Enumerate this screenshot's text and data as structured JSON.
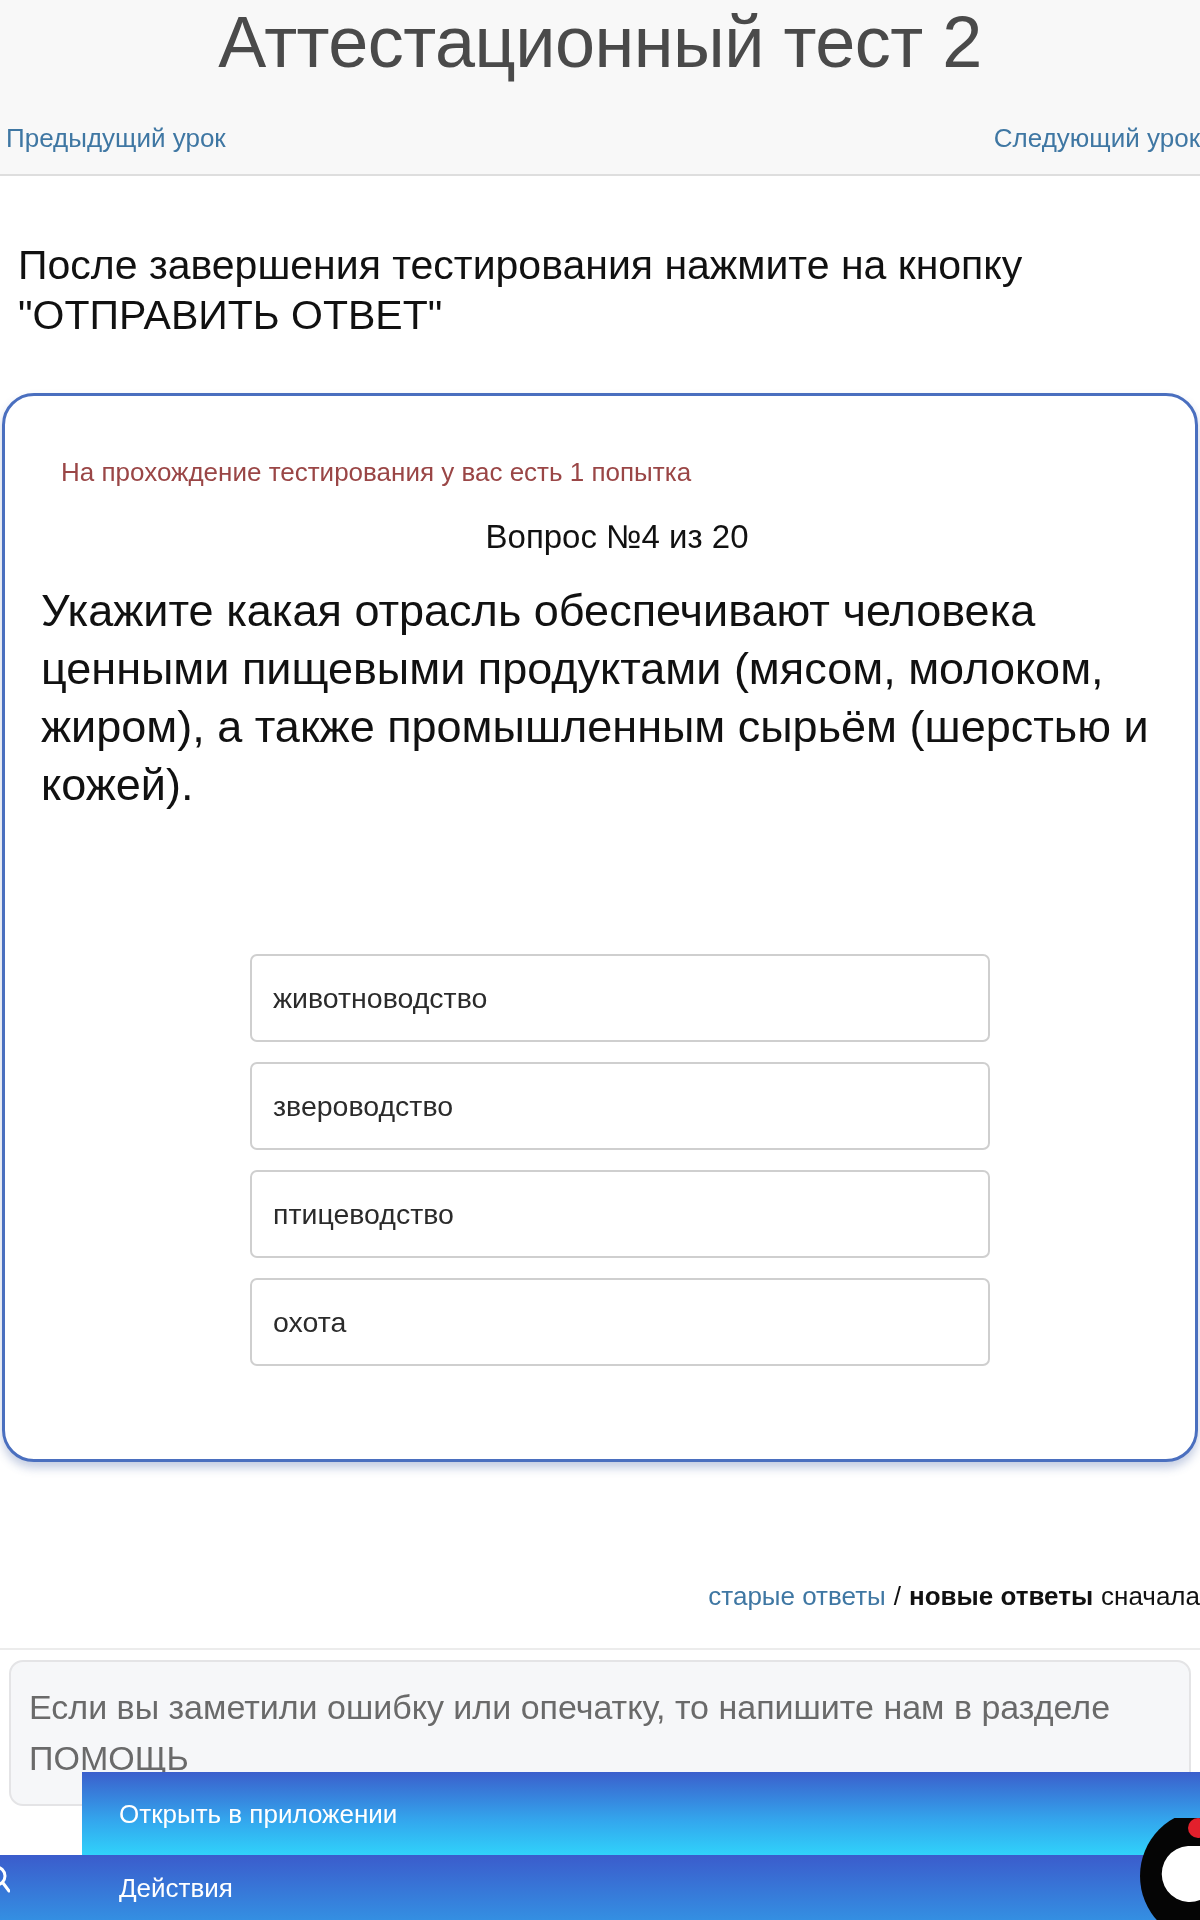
{
  "header": {
    "title": "Аттестационный тест 2",
    "prev_link": "Предыдущий урок",
    "next_link": "Следующий урок"
  },
  "instruction": "После завершения тестирования нажмите на кнопку \"ОТПРАВИТЬ ОТВЕТ\"",
  "test": {
    "attempts_notice": "На прохождение тестирования у вас есть 1 попытка",
    "question_number": "Вопрос №4 из 20",
    "question": "Укажите какая отрасль обеспечивают человека ценными пищевыми продуктами (мясом, молоком, жиром), а также промышленным сырьём (шерстью и кожей).",
    "answers": [
      {
        "label": "животноводство",
        "selected": false
      },
      {
        "label": "звероводство",
        "selected": false
      },
      {
        "label": "птицеводство",
        "selected": false
      },
      {
        "label": "охота",
        "selected": false
      }
    ]
  },
  "answer_sort": {
    "options": [
      {
        "label": "старые ответы",
        "selected": false
      },
      {
        "label": "новые ответы",
        "selected": true
      }
    ],
    "separator": "/",
    "suffix": "сначала"
  },
  "help_notice": "Если вы заметили ошибку или опечатку, то напишите нам в разделе ПОМОЩЬ",
  "app_banner": {
    "label": "Открыть в приложении"
  },
  "actions_bar": {
    "label": "Действия"
  }
}
